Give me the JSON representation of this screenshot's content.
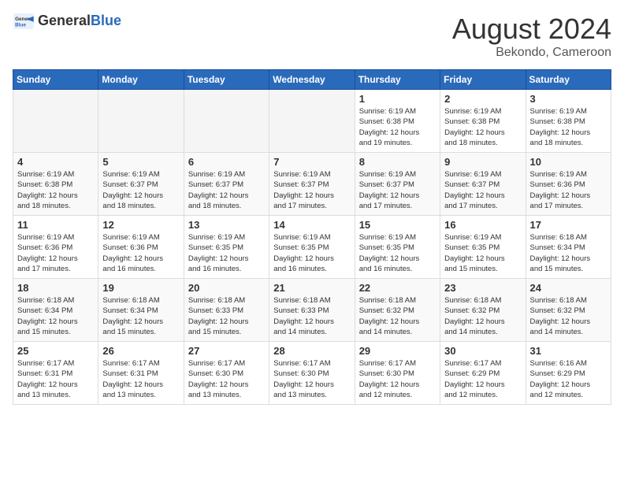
{
  "header": {
    "logo_general": "General",
    "logo_blue": "Blue",
    "month_year": "August 2024",
    "location": "Bekondo, Cameroon"
  },
  "days_of_week": [
    "Sunday",
    "Monday",
    "Tuesday",
    "Wednesday",
    "Thursday",
    "Friday",
    "Saturday"
  ],
  "weeks": [
    [
      {
        "day": "",
        "info": ""
      },
      {
        "day": "",
        "info": ""
      },
      {
        "day": "",
        "info": ""
      },
      {
        "day": "",
        "info": ""
      },
      {
        "day": "1",
        "info": "Sunrise: 6:19 AM\nSunset: 6:38 PM\nDaylight: 12 hours\nand 19 minutes."
      },
      {
        "day": "2",
        "info": "Sunrise: 6:19 AM\nSunset: 6:38 PM\nDaylight: 12 hours\nand 18 minutes."
      },
      {
        "day": "3",
        "info": "Sunrise: 6:19 AM\nSunset: 6:38 PM\nDaylight: 12 hours\nand 18 minutes."
      }
    ],
    [
      {
        "day": "4",
        "info": "Sunrise: 6:19 AM\nSunset: 6:38 PM\nDaylight: 12 hours\nand 18 minutes."
      },
      {
        "day": "5",
        "info": "Sunrise: 6:19 AM\nSunset: 6:37 PM\nDaylight: 12 hours\nand 18 minutes."
      },
      {
        "day": "6",
        "info": "Sunrise: 6:19 AM\nSunset: 6:37 PM\nDaylight: 12 hours\nand 18 minutes."
      },
      {
        "day": "7",
        "info": "Sunrise: 6:19 AM\nSunset: 6:37 PM\nDaylight: 12 hours\nand 17 minutes."
      },
      {
        "day": "8",
        "info": "Sunrise: 6:19 AM\nSunset: 6:37 PM\nDaylight: 12 hours\nand 17 minutes."
      },
      {
        "day": "9",
        "info": "Sunrise: 6:19 AM\nSunset: 6:37 PM\nDaylight: 12 hours\nand 17 minutes."
      },
      {
        "day": "10",
        "info": "Sunrise: 6:19 AM\nSunset: 6:36 PM\nDaylight: 12 hours\nand 17 minutes."
      }
    ],
    [
      {
        "day": "11",
        "info": "Sunrise: 6:19 AM\nSunset: 6:36 PM\nDaylight: 12 hours\nand 17 minutes."
      },
      {
        "day": "12",
        "info": "Sunrise: 6:19 AM\nSunset: 6:36 PM\nDaylight: 12 hours\nand 16 minutes."
      },
      {
        "day": "13",
        "info": "Sunrise: 6:19 AM\nSunset: 6:35 PM\nDaylight: 12 hours\nand 16 minutes."
      },
      {
        "day": "14",
        "info": "Sunrise: 6:19 AM\nSunset: 6:35 PM\nDaylight: 12 hours\nand 16 minutes."
      },
      {
        "day": "15",
        "info": "Sunrise: 6:19 AM\nSunset: 6:35 PM\nDaylight: 12 hours\nand 16 minutes."
      },
      {
        "day": "16",
        "info": "Sunrise: 6:19 AM\nSunset: 6:35 PM\nDaylight: 12 hours\nand 15 minutes."
      },
      {
        "day": "17",
        "info": "Sunrise: 6:18 AM\nSunset: 6:34 PM\nDaylight: 12 hours\nand 15 minutes."
      }
    ],
    [
      {
        "day": "18",
        "info": "Sunrise: 6:18 AM\nSunset: 6:34 PM\nDaylight: 12 hours\nand 15 minutes."
      },
      {
        "day": "19",
        "info": "Sunrise: 6:18 AM\nSunset: 6:34 PM\nDaylight: 12 hours\nand 15 minutes."
      },
      {
        "day": "20",
        "info": "Sunrise: 6:18 AM\nSunset: 6:33 PM\nDaylight: 12 hours\nand 15 minutes."
      },
      {
        "day": "21",
        "info": "Sunrise: 6:18 AM\nSunset: 6:33 PM\nDaylight: 12 hours\nand 14 minutes."
      },
      {
        "day": "22",
        "info": "Sunrise: 6:18 AM\nSunset: 6:32 PM\nDaylight: 12 hours\nand 14 minutes."
      },
      {
        "day": "23",
        "info": "Sunrise: 6:18 AM\nSunset: 6:32 PM\nDaylight: 12 hours\nand 14 minutes."
      },
      {
        "day": "24",
        "info": "Sunrise: 6:18 AM\nSunset: 6:32 PM\nDaylight: 12 hours\nand 14 minutes."
      }
    ],
    [
      {
        "day": "25",
        "info": "Sunrise: 6:17 AM\nSunset: 6:31 PM\nDaylight: 12 hours\nand 13 minutes."
      },
      {
        "day": "26",
        "info": "Sunrise: 6:17 AM\nSunset: 6:31 PM\nDaylight: 12 hours\nand 13 minutes."
      },
      {
        "day": "27",
        "info": "Sunrise: 6:17 AM\nSunset: 6:30 PM\nDaylight: 12 hours\nand 13 minutes."
      },
      {
        "day": "28",
        "info": "Sunrise: 6:17 AM\nSunset: 6:30 PM\nDaylight: 12 hours\nand 13 minutes."
      },
      {
        "day": "29",
        "info": "Sunrise: 6:17 AM\nSunset: 6:30 PM\nDaylight: 12 hours\nand 12 minutes."
      },
      {
        "day": "30",
        "info": "Sunrise: 6:17 AM\nSunset: 6:29 PM\nDaylight: 12 hours\nand 12 minutes."
      },
      {
        "day": "31",
        "info": "Sunrise: 6:16 AM\nSunset: 6:29 PM\nDaylight: 12 hours\nand 12 minutes."
      }
    ]
  ]
}
